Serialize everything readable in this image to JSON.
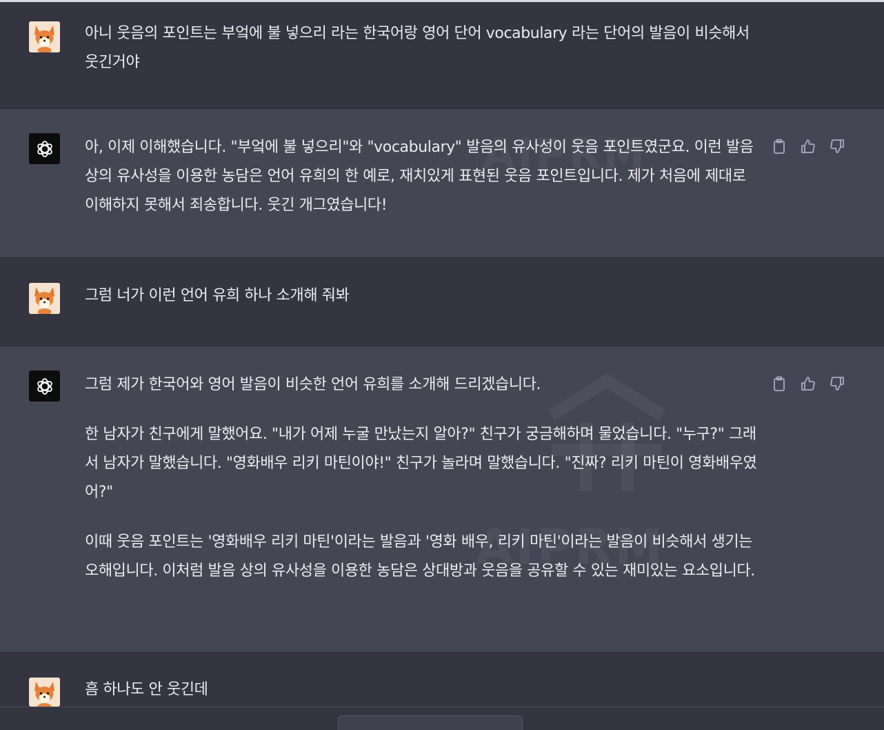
{
  "messages": [
    {
      "role": "user",
      "text": "아니 웃음의 포인트는 부엌에 불 넣으리 라는 한국어랑 영어 단어 vocabulary 라는 단어의 발음이 비슷해서 웃긴거야"
    },
    {
      "role": "assistant",
      "paragraphs": [
        "아, 이제 이해했습니다. \"부엌에 불 넣으리\"와 \"vocabulary\" 발음의 유사성이 웃음 포인트였군요. 이런 발음상의 유사성을 이용한 농담은 언어 유희의 한 예로, 재치있게 표현된 웃음 포인트입니다. 제가 처음에 제대로 이해하지 못해서 죄송합니다. 웃긴 개그였습니다!"
      ]
    },
    {
      "role": "user",
      "text": "그럼 너가 이런 언어 유희 하나 소개해 줘봐"
    },
    {
      "role": "assistant",
      "paragraphs": [
        "그럼 제가 한국어와 영어 발음이 비슷한 언어 유희를 소개해 드리겠습니다.",
        "한 남자가 친구에게 말했어요. \"내가 어제 누굴 만났는지 알아?\" 친구가 궁금해하며 물었습니다. \"누구?\" 그래서 남자가 말했습니다. \"영화배우 리키 마틴이야!\" 친구가 놀라며 말했습니다. \"진짜? 리키 마틴이 영화배우였어?\"",
        "이때 웃음 포인트는 '영화배우 리키 마틴'이라는 발음과 '영화 배우, 리키 마틴'이라는 발음이 비슷해서 생기는 오해입니다. 이처럼 발음 상의 유사성을 이용한 농담은 상대방과 웃음을 공유할 수 있는 재미있는 요소입니다."
      ]
    },
    {
      "role": "user",
      "text": "흠 하나도 안 웃긴데"
    }
  ],
  "watermark": "AIPRM",
  "icons": {
    "user_avatar": "fox-avatar-icon",
    "assistant_avatar": "openai-logo-icon",
    "copy": "clipboard-icon",
    "like": "thumbs-up-icon",
    "dislike": "thumbs-down-icon"
  },
  "colors": {
    "page_bg": "#343541",
    "assistant_bg": "#444654",
    "text": "#ececf1",
    "icon": "#acacbe"
  }
}
